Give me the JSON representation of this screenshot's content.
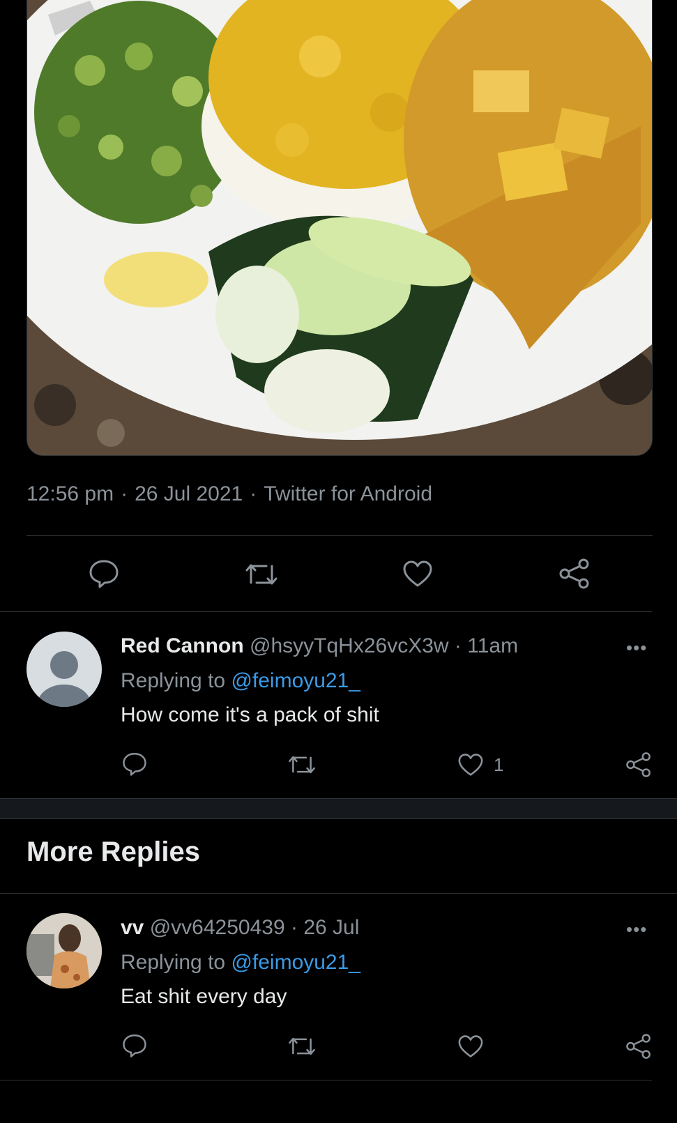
{
  "tweet": {
    "time": "12:56 pm",
    "date": "26 Jul 2021",
    "source": "Twitter for Android",
    "separator": "·"
  },
  "section_title": "More Replies",
  "replies": [
    {
      "name": "Red Cannon",
      "handle": "@hsyyTqHx26vcX3w",
      "time": "11am",
      "replying_label": "Replying to",
      "replying_to": "@feimoyu21_",
      "text": "How come it's a pack of shit",
      "like_count": "1"
    },
    {
      "name": "vv",
      "handle": "@vv64250439",
      "time": "26 Jul",
      "replying_label": "Replying to",
      "replying_to": "@feimoyu21_",
      "text": "Eat shit every day",
      "like_count": ""
    }
  ],
  "colors": {
    "background": "#000000",
    "divider": "#2f3336",
    "muted": "#8b9299",
    "link": "#3b9be6"
  },
  "icons": [
    "reply-icon",
    "retweet-icon",
    "like-icon",
    "share-icon",
    "more-icon"
  ]
}
